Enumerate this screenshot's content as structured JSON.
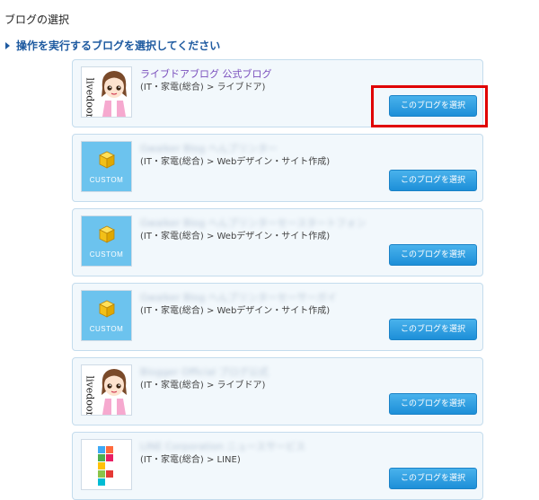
{
  "page": {
    "heading": "ブログの選択",
    "instruction": "操作を実行するブログを選択してください"
  },
  "blogs": [
    {
      "title": "ライブドアブログ 公式ブログ",
      "category": "(IT・家電(総合) > ライブドア)",
      "thumbnail": "livedoor-character",
      "button_label": "このブログを選択"
    },
    {
      "title": "Gwalker Blog へんブリンター",
      "category": "(IT・家電(総合) > Webデザイン・サイト作成)",
      "thumbnail": "custom-cube",
      "button_label": "このブログを選択"
    },
    {
      "title": "Gwalker Blog へんブリンターセースタートフォン",
      "category": "(IT・家電(総合) > Webデザイン・サイト作成)",
      "thumbnail": "custom-cube",
      "button_label": "このブログを選択"
    },
    {
      "title": "Gwalker Blog へんブリンターセーサーガイ",
      "category": "(IT・家電(総合) > Webデザイン・サイト作成)",
      "thumbnail": "custom-cube",
      "button_label": "このブログを選択"
    },
    {
      "title": "Blogger Official ブログ公式",
      "category": "(IT・家電(総合) > ライブドア)",
      "thumbnail": "livedoor-character",
      "button_label": "このブログを選択"
    },
    {
      "title": "LINE Corporation ニュースサービス",
      "category": "(IT・家電(総合) > LINE)",
      "thumbnail": "line-blocks",
      "button_label": "このブログを選択"
    }
  ],
  "colors": {
    "accent": "#1e5aa0",
    "button": "#2a9de3",
    "highlight": "#e00000",
    "card_bg": "#f2f8fc"
  },
  "custom_label": "CUSTOM",
  "livedoor_label": "livedoor"
}
